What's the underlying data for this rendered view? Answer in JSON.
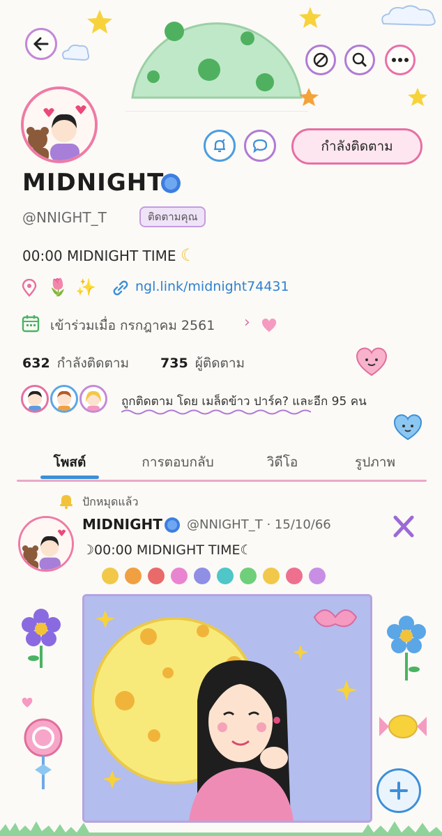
{
  "profile": {
    "name": "MIDNIGHT",
    "handle": "@NNIGHT_T",
    "follows_you": "ติดตามคุณ",
    "bio": "00:00 MIDNIGHT TIME",
    "link": "ngl.link/midnight74431",
    "joined": "เข้าร่วมเมื่อ กรกฎาคม 2561",
    "following_count": "632",
    "following_label": "กำลังติดตาม",
    "followers_count": "735",
    "followers_label": "ผู้ติดตาม",
    "followed_by": "ถูกติดตาม โดย เมล็ดข้าว ปาร์ค? และอีก 95 คน"
  },
  "actions": {
    "following_button": "กำลังติดตาม"
  },
  "tabs": [
    "โพสต์",
    "การตอบกลับ",
    "วิดีโอ",
    "รูปภาพ"
  ],
  "active_tab": 0,
  "post": {
    "pinned_label": "ปักหมุดแล้ว",
    "author": "MIDNIGHT",
    "handle": "@NNIGHT_T",
    "separator": "·",
    "date": "15/10/66",
    "text": "☽00:00 MIDNIGHT TIME☾",
    "dot_colors": [
      "#f2c84b",
      "#f0a040",
      "#e96a6a",
      "#e985d0",
      "#8f8fe6",
      "#4fc6c8",
      "#6fcf7a",
      "#f2c84b",
      "#ef6f8f",
      "#c88ee6"
    ]
  },
  "colors": {
    "accent_pink": "#ef7aa6",
    "accent_purple": "#b07ad6",
    "accent_blue": "#3c8fd8",
    "verified_blue": "#3d7ee0"
  },
  "icons": [
    "back-arrow-icon",
    "no-sign-icon",
    "search-icon",
    "more-icon",
    "notify-bell-icon",
    "message-icon",
    "verified-icon",
    "location-icon",
    "link-icon",
    "calendar-icon",
    "chevron-right-icon",
    "pin-bell-icon",
    "x-logo-icon",
    "plus-icon"
  ]
}
